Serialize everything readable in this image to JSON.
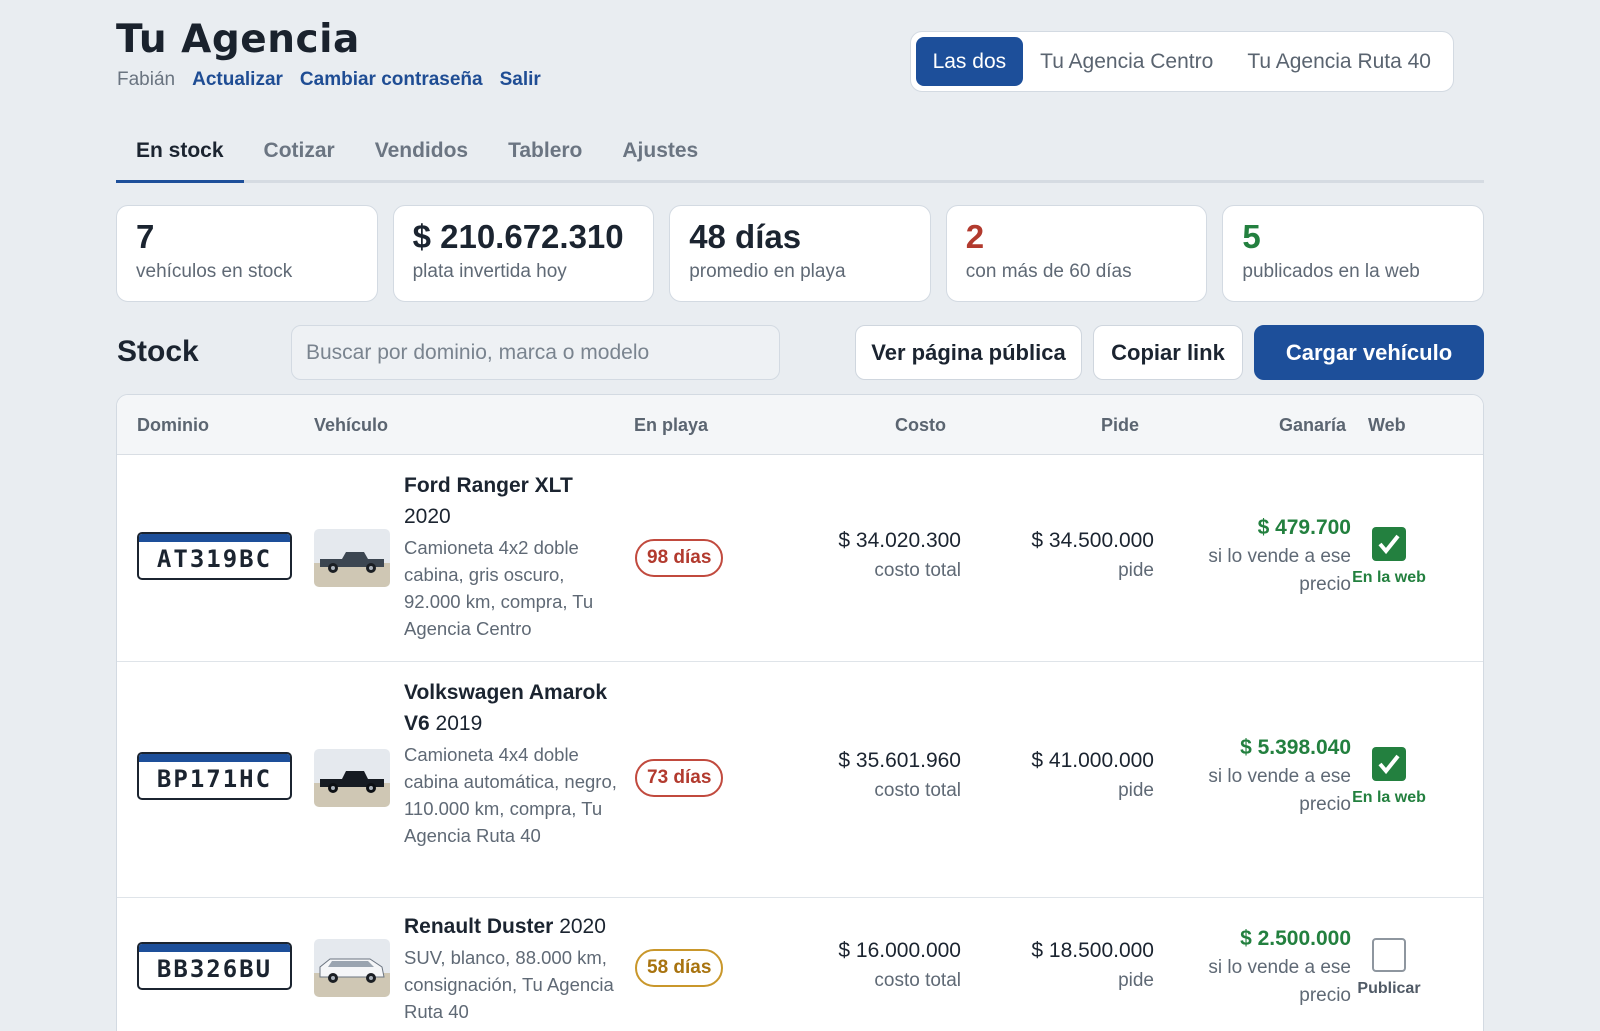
{
  "app": {
    "title": "Tu Agencia",
    "user": "Fabián",
    "links": [
      "Actualizar",
      "Cambiar contraseña",
      "Salir"
    ]
  },
  "branches": {
    "options": [
      "Las dos",
      "Tu Agencia Centro",
      "Tu Agencia Ruta 40"
    ],
    "selected": "Las dos"
  },
  "tabs": [
    "En stock",
    "Cotizar",
    "Vendidos",
    "Tablero",
    "Ajustes"
  ],
  "active_tab": "En stock",
  "stats": [
    {
      "value": "7",
      "label": "vehículos en stock"
    },
    {
      "value": "$ 210.672.310",
      "label": "plata invertida hoy"
    },
    {
      "value": "48 días",
      "label": "promedio en playa"
    },
    {
      "value": "2",
      "label": "con más de 60 días"
    },
    {
      "value": "5",
      "label": "publicados en la web"
    }
  ],
  "stock": {
    "title": "Stock",
    "search_placeholder": "Buscar por dominio, marca o modelo",
    "btn_public": "Ver página pública",
    "btn_copy": "Copiar link",
    "btn_load": "Cargar vehículo"
  },
  "table": {
    "headers": {
      "dominio": "Dominio",
      "vehiculo": "Vehículo",
      "en_playa": "En playa",
      "costo": "Costo",
      "pide": "Pide",
      "ganaria": "Ganaría",
      "web": "Web"
    },
    "cost_sub": "costo total",
    "ask_sub": "pide",
    "gain_sub": "si lo vende a ese precio",
    "rows": [
      {
        "plate": "AT319BC",
        "name_bold": "Ford Ranger XLT",
        "year": "2020",
        "desc": "Camioneta 4x2 doble cabina, gris oscuro, 92.000 km, compra, Tu Agencia Centro",
        "days": "98 días",
        "days_level": "red",
        "cost": "$ 34.020.300",
        "ask": "$ 34.500.000",
        "gain": "$ 479.700",
        "web": true,
        "web_label": "En la web",
        "car_color": "#3c4651"
      },
      {
        "plate": "BP171HC",
        "name_bold": "Volkswagen Amarok V6",
        "year": "2019",
        "desc": "Camioneta 4x4 doble cabina automática, negro, 110.000 km, compra, Tu Agencia Ruta 40",
        "days": "73 días",
        "days_level": "red",
        "cost": "$ 35.601.960",
        "ask": "$ 41.000.000",
        "gain": "$ 5.398.040",
        "web": true,
        "web_label": "En la web",
        "car_color": "#161b22"
      },
      {
        "plate": "BB326BU",
        "name_bold": "Renault Duster",
        "year": "2020",
        "desc": "SUV, blanco, 88.000 km, consignación, Tu Agencia Ruta 40",
        "days": "58 días",
        "days_level": "amber",
        "cost": "$ 16.000.000",
        "ask": "$ 18.500.000",
        "gain": "$ 2.500.000",
        "web": false,
        "web_label": "Publicar",
        "car_color": "#f2f4f6"
      }
    ]
  }
}
